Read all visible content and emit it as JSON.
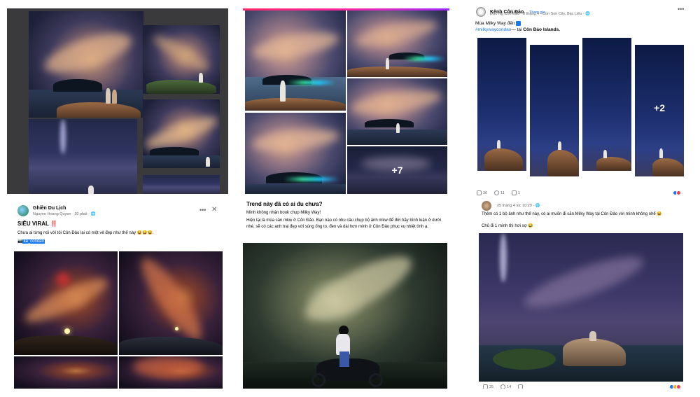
{
  "cell1": {},
  "cell2": {
    "more_count": "+7"
  },
  "cell3": {
    "page_name": "Kênh Côn Đảo",
    "join_label": "Tham gia",
    "author": "Đức Ng Côn Đảo",
    "date": "8 tháng 4",
    "location": "Con Son City, Bạc Liêu",
    "post_line1": "Mùa Milky Way đến",
    "hashtag": "#milkywaycondao",
    "post_line2_suffix": "— tại",
    "place": "Côn Đảo Islands.",
    "more_count": "+2",
    "likes": "36",
    "comments": "11",
    "shares": "1"
  },
  "cell4": {
    "page_name": "Ghiền Du Lịch",
    "author": "Nguyen Hoang Quyen",
    "time": "20 phút",
    "title": "SIÊU VIRAL",
    "title_mark": "‼️",
    "body": "Chưa ai từng nói với tôi Côn Đảo lại có một vẻ đẹp như thế này 😆😆😆.",
    "tag_prefix": "📷",
    "tag": "ka_condao"
  },
  "cell5": {
    "heading": "Trend này đã có ai đu chưa?",
    "line1": "Mình không nhận book chụp Milky Way!",
    "body": "Hiện tại là mùa săn mkw ở Côn Đảo. Bạn nào có nhu cầu chụp bộ ảnh mkw để đời hãy bình luận ở dưới nhé, sẽ có các anh trai đẹp với súng ống to, đen và dài hơn mình ở Côn Đảo phục vụ nhiệt tình ạ."
  },
  "cell6": {
    "date": "25 tháng 4 lúc 10:29",
    "line1": "Thêm có 1 bộ ảnh như thế này, có ai muốn đi săn Milky Way tại Côn Đảo với mình không nhể 😆",
    "line2": "Chủ đi 1 mình thì hơi sợ 😂",
    "likes": "25",
    "comments": "14"
  },
  "colors": {
    "fb_blue": "#1877f2",
    "muted": "#65676b",
    "bg": "#f0f2f5"
  }
}
